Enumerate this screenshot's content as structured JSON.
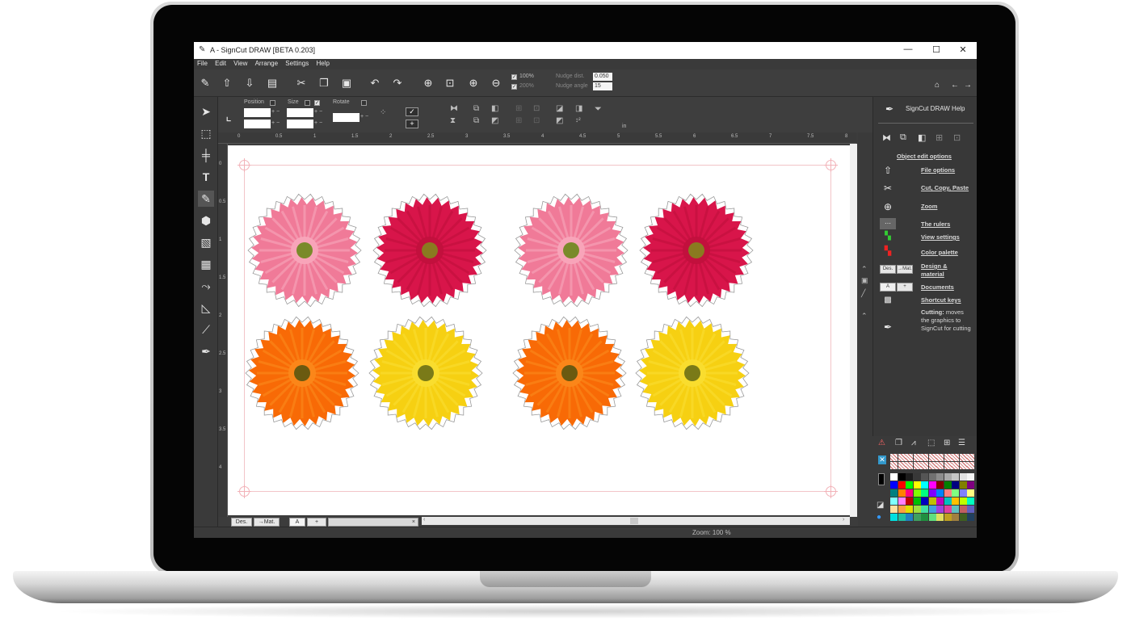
{
  "window": {
    "title": "A - SignCut DRAW  [BETA 0.203]"
  },
  "menu": [
    "File",
    "Edit",
    "View",
    "Arrange",
    "Settings",
    "Help"
  ],
  "toolbar": {
    "zoom_100_label": "100%",
    "zoom_200_label": "200%",
    "nudge_distance_label": "Nudge dist.",
    "nudge_distance_value": "0.050",
    "nudge_angle_label": "Nudge angle",
    "nudge_angle_value": "15"
  },
  "properties": {
    "position_label": "Position",
    "size_label": "Size",
    "rotate_label": "Rotate",
    "unit_label": "in"
  },
  "ruler": {
    "top": [
      "0",
      "0.5",
      "1",
      "1.5",
      "2",
      "2.5",
      "3",
      "3.5",
      "4",
      "4.5",
      "5",
      "5.5",
      "6",
      "6.5",
      "7",
      "7.5",
      "8"
    ],
    "left": [
      "0",
      "0.5",
      "1",
      "1.5",
      "2",
      "2.5",
      "3",
      "3.5",
      "4"
    ]
  },
  "flowers": [
    {
      "color": "#f07a98",
      "center": "#7a8a2a",
      "petal": "#f8a8bc"
    },
    {
      "color": "#d8154a",
      "center": "#8a7a20",
      "petal": "#c0103c"
    },
    {
      "color": "#f07a98",
      "center": "#7a8a2a",
      "petal": "#f8a8bc"
    },
    {
      "color": "#d8154a",
      "center": "#8a7a20",
      "petal": "#c0103c"
    },
    {
      "color": "#f86a06",
      "center": "#6a5a10",
      "petal": "#fb8a1c"
    },
    {
      "color": "#f6d012",
      "center": "#7a7a18",
      "petal": "#fade32"
    },
    {
      "color": "#f86a06",
      "center": "#6a5a10",
      "petal": "#fb8a1c"
    },
    {
      "color": "#f6d012",
      "center": "#7a7a18",
      "petal": "#fade32"
    }
  ],
  "doc_tabs": {
    "design": "Des.",
    "material": "→Mat.",
    "doc_a": "A",
    "add": "+",
    "close": "×"
  },
  "status": {
    "zoom_text": "Zoom: 100 %"
  },
  "help_panel": {
    "title": "SignCut DRAW Help",
    "object_edit": "Object edit options",
    "links": [
      {
        "icon": "upload-icon",
        "label": "File options"
      },
      {
        "icon": "scissors-icon",
        "label": "Cut, Copy, Paste"
      },
      {
        "icon": "zoom-icon",
        "label": "Zoom"
      },
      {
        "icon": "ruler-icon",
        "label": "The rulers"
      },
      {
        "icon": "view-settings-icon",
        "label": "View settings"
      },
      {
        "icon": "palette-icon",
        "label": "Color palette"
      },
      {
        "icon": "design-material-icon",
        "label": "Design & material",
        "design_tag": "Des.",
        "material_tag": "→Mat."
      },
      {
        "icon": "documents-icon",
        "label": "Documents",
        "doc_tag": "A",
        "add_tag": "+"
      },
      {
        "icon": "keyboard-icon",
        "label": "Shortcut keys"
      }
    ],
    "cutting_bold": "Cutting:",
    "cutting_text": " moves the graphics to SignCut for cutting"
  },
  "colors": {
    "ui_dark": "#3c3c3c",
    "page": "#ffffff",
    "guide": "#f2c4c8"
  },
  "palette": [
    "#ffffff",
    "#000000",
    "#1c1c1c",
    "#383838",
    "#555555",
    "#717171",
    "#8d8d8d",
    "#aaaaaa",
    "#c6c6c6",
    "#e2e2e2",
    "#f5f5f5",
    "#0000ff",
    "#ff0000",
    "#00ff00",
    "#ffff00",
    "#00ffff",
    "#ff00ff",
    "#800000",
    "#008000",
    "#000080",
    "#808000",
    "#800080",
    "#008080",
    "#ff8000",
    "#ff0080",
    "#80ff00",
    "#00ff80",
    "#8000ff",
    "#0080ff",
    "#ff8080",
    "#80ff80",
    "#8080ff",
    "#ffff80",
    "#80ffff",
    "#ff80ff",
    "#c00000",
    "#00c000",
    "#0000c0",
    "#c0c000",
    "#c000c0",
    "#00c0c0",
    "#ffc000",
    "#c0ff00",
    "#00ffc0",
    "#ffe0a0",
    "#ffa040",
    "#e0e000",
    "#a0e040",
    "#40e0a0",
    "#40a0e0",
    "#a040e0",
    "#e040a0",
    "#60c0c0",
    "#c06060",
    "#6060c0",
    "#00e0e0",
    "#20c0a0",
    "#2080c0",
    "#40a060",
    "#209040",
    "#60e080",
    "#e0e060",
    "#c0a020",
    "#a08040",
    "#406020",
    "#204060"
  ]
}
